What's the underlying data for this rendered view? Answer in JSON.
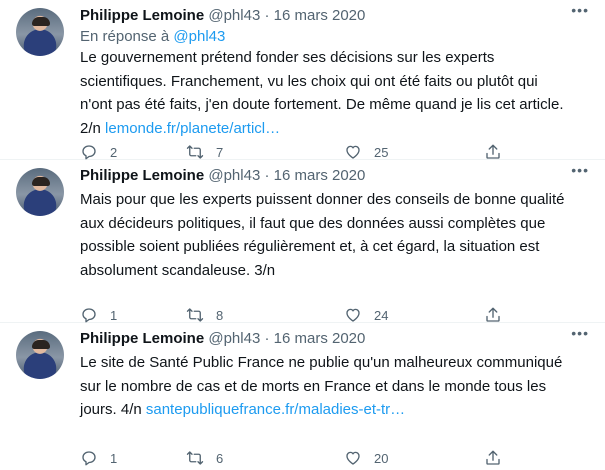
{
  "tweets": [
    {
      "author": "Philippe Lemoine",
      "handle": "@phl43",
      "date": "16 mars 2020",
      "reply_prefix": "En réponse à",
      "reply_to": "@phl43",
      "text_lines": [
        "Le gouvernement prétend fonder ses décisions sur les experts",
        "scientifiques. Franchement, vu les choix qui ont été faits ou plutôt qui",
        "n'ont pas été faits, j'en doute fortement. De même quand je lis cet article."
      ],
      "last_line": "2/n",
      "link": "lemonde.fr/planete/articl…",
      "replies": "2",
      "retweets": "7",
      "likes": "25"
    },
    {
      "author": "Philippe Lemoine",
      "handle": "@phl43",
      "date": "16 mars 2020",
      "text_lines": [
        "Mais pour que les experts puissent donner des conseils de bonne qualité",
        "aux décideurs politiques, il faut que des données aussi complètes que",
        "possible soient publiées régulièrement et, à cet égard, la situation est",
        "absolument scandaleuse. 3/n"
      ],
      "replies": "1",
      "retweets": "8",
      "likes": "24"
    },
    {
      "author": "Philippe Lemoine",
      "handle": "@phl43",
      "date": "16 mars 2020",
      "text_lines": [
        "Le site de Santé Public France ne publie qu'un malheureux communiqué",
        "sur le nombre de cas et de morts en France et dans le monde tous les"
      ],
      "last_line": "jours. 4/n",
      "link": "santepubliquefrance.fr/maladies-et-tr…",
      "replies": "1",
      "retweets": "6",
      "likes": "20"
    }
  ],
  "icons": {
    "more": "more-dots-icon",
    "reply": "reply-bubble-icon",
    "retweet": "retweet-icon",
    "like": "heart-icon",
    "share": "share-icon"
  },
  "colors": {
    "link": "#1d9bf0",
    "secondary_text": "#536471",
    "primary_text": "#0f1419"
  }
}
